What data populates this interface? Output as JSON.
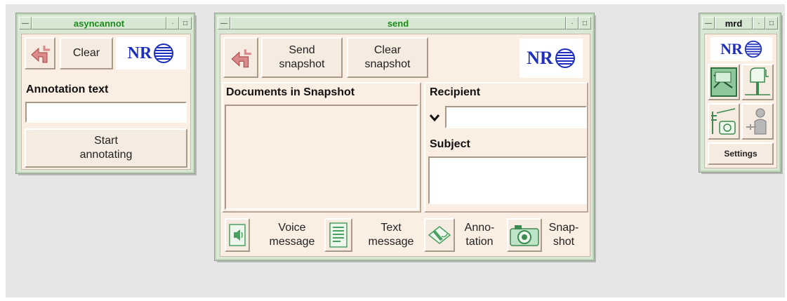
{
  "colors": {
    "desktop": "#e6e6e6",
    "frame": "#d8e8d4",
    "client": "#fbeee3",
    "title_text": "#1a8a1a",
    "logo": "#1e2fbf",
    "back_arrow": "#d07a7a"
  },
  "async_window": {
    "title": "asyncannot",
    "clear_label": "Clear",
    "logo_text": "NR",
    "annotation_label": "Annotation text",
    "annotation_value": "",
    "start_label": "Start\nannotating"
  },
  "send_window": {
    "title": "send",
    "send_snapshot_label": "Send\nsnapshot",
    "clear_snapshot_label": "Clear\nsnapshot",
    "logo_text": "NR",
    "documents_label": "Documents in Snapshot",
    "recipient_label": "Recipient",
    "recipient_value": "",
    "subject_label": "Subject",
    "subject_value": "",
    "tools": [
      {
        "label": "Voice\nmessage",
        "icon": "speaker-icon"
      },
      {
        "label": "Text\nmessage",
        "icon": "document-icon"
      },
      {
        "label": "Anno-\ntation",
        "icon": "pen-icon"
      },
      {
        "label": "Snap-\nshot",
        "icon": "camera-icon"
      }
    ]
  },
  "mrd_window": {
    "title": "mrd",
    "logo_text": "NR",
    "settings_label": "Settings",
    "icons": [
      "mail-icon",
      "mailbox-icon",
      "telephone-icon",
      "person-icon"
    ]
  }
}
